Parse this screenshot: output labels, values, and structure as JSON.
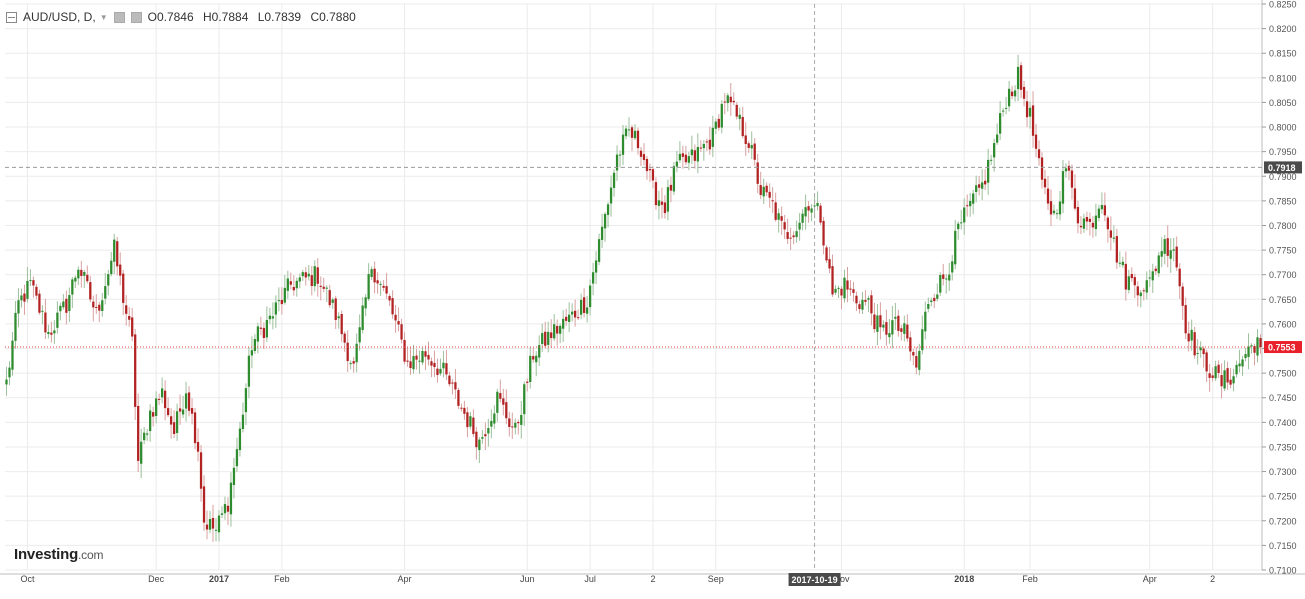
{
  "legend": {
    "symbol": "AUD/USD, D,",
    "open": "O0.7846",
    "high": "H0.7884",
    "low": "L0.7839",
    "close": "C0.7880"
  },
  "logo": {
    "name": "Investing",
    "suffix": ".com"
  },
  "colors": {
    "up": "#2e8b2e",
    "down": "#b22222",
    "wick_up": "#9bbf9b",
    "wick_down": "#d9a0a0",
    "price_line": "#e84040",
    "cross_line": "#b0b0b0",
    "grid": "#ebebeb"
  },
  "chart_data": {
    "type": "candlestick",
    "title": "AUD/USD, D,",
    "ylim": [
      0.71,
      0.825
    ],
    "y_ticks": [
      "0.7100",
      "0.7150",
      "0.7200",
      "0.7250",
      "0.7300",
      "0.7350",
      "0.7400",
      "0.7450",
      "0.7500",
      "0.7550",
      "0.7600",
      "0.7650",
      "0.7700",
      "0.7750",
      "0.7800",
      "0.7850",
      "0.7900",
      "0.7950",
      "0.8000",
      "0.8050",
      "0.8100",
      "0.8150",
      "0.8200",
      "0.8250"
    ],
    "x_ticks": [
      {
        "label": "Oct",
        "index": 7,
        "bold": false
      },
      {
        "label": "Dec",
        "index": 50,
        "bold": false
      },
      {
        "label": "2017",
        "index": 71,
        "bold": true
      },
      {
        "label": "Feb",
        "index": 92,
        "bold": false
      },
      {
        "label": "Apr",
        "index": 133,
        "bold": false
      },
      {
        "label": "Jun",
        "index": 174,
        "bold": false
      },
      {
        "label": "Jul",
        "index": 195,
        "bold": false
      },
      {
        "label": "2",
        "index": 216,
        "bold": false
      },
      {
        "label": "Sep",
        "index": 237,
        "bold": false
      },
      {
        "label": "Nov",
        "index": 279,
        "bold": false
      },
      {
        "label": "2018",
        "index": 320,
        "bold": true
      },
      {
        "label": "Feb",
        "index": 342,
        "bold": false
      },
      {
        "label": "Apr",
        "index": 382,
        "bold": false
      },
      {
        "label": "2",
        "index": 403,
        "bold": false
      }
    ],
    "current_price": {
      "value": 0.7553,
      "label": "0.7553"
    },
    "crosshair": {
      "price": 0.7918,
      "price_label": "0.7918",
      "index": 270,
      "date_label": "2017-10-19"
    },
    "close_anchors": [
      [
        0,
        0.748
      ],
      [
        4,
        0.764
      ],
      [
        8,
        0.768
      ],
      [
        14,
        0.758
      ],
      [
        20,
        0.764
      ],
      [
        24,
        0.772
      ],
      [
        30,
        0.762
      ],
      [
        36,
        0.775
      ],
      [
        42,
        0.756
      ],
      [
        44,
        0.732
      ],
      [
        48,
        0.742
      ],
      [
        52,
        0.746
      ],
      [
        56,
        0.738
      ],
      [
        60,
        0.747
      ],
      [
        64,
        0.735
      ],
      [
        66,
        0.72
      ],
      [
        70,
        0.718
      ],
      [
        74,
        0.724
      ],
      [
        78,
        0.738
      ],
      [
        82,
        0.756
      ],
      [
        88,
        0.761
      ],
      [
        95,
        0.768
      ],
      [
        104,
        0.77
      ],
      [
        110,
        0.762
      ],
      [
        116,
        0.751
      ],
      [
        122,
        0.772
      ],
      [
        128,
        0.764
      ],
      [
        134,
        0.752
      ],
      [
        140,
        0.754
      ],
      [
        146,
        0.75
      ],
      [
        152,
        0.743
      ],
      [
        158,
        0.736
      ],
      [
        164,
        0.745
      ],
      [
        170,
        0.738
      ],
      [
        176,
        0.754
      ],
      [
        182,
        0.758
      ],
      [
        188,
        0.761
      ],
      [
        194,
        0.765
      ],
      [
        200,
        0.782
      ],
      [
        204,
        0.794
      ],
      [
        208,
        0.799
      ],
      [
        212,
        0.796
      ],
      [
        216,
        0.787
      ],
      [
        220,
        0.784
      ],
      [
        224,
        0.792
      ],
      [
        230,
        0.794
      ],
      [
        236,
        0.798
      ],
      [
        240,
        0.806
      ],
      [
        244,
        0.802
      ],
      [
        248,
        0.797
      ],
      [
        252,
        0.787
      ],
      [
        256,
        0.784
      ],
      [
        260,
        0.778
      ],
      [
        264,
        0.78
      ],
      [
        268,
        0.785
      ],
      [
        272,
        0.782
      ],
      [
        276,
        0.766
      ],
      [
        280,
        0.768
      ],
      [
        284,
        0.765
      ],
      [
        288,
        0.764
      ],
      [
        292,
        0.758
      ],
      [
        296,
        0.76
      ],
      [
        300,
        0.758
      ],
      [
        304,
        0.751
      ],
      [
        308,
        0.765
      ],
      [
        314,
        0.77
      ],
      [
        318,
        0.779
      ],
      [
        322,
        0.784
      ],
      [
        326,
        0.788
      ],
      [
        330,
        0.796
      ],
      [
        334,
        0.806
      ],
      [
        338,
        0.81
      ],
      [
        342,
        0.802
      ],
      [
        346,
        0.788
      ],
      [
        350,
        0.782
      ],
      [
        354,
        0.792
      ],
      [
        358,
        0.782
      ],
      [
        362,
        0.78
      ],
      [
        366,
        0.786
      ],
      [
        370,
        0.776
      ],
      [
        374,
        0.769
      ],
      [
        378,
        0.768
      ],
      [
        382,
        0.768
      ],
      [
        386,
        0.776
      ],
      [
        390,
        0.776
      ],
      [
        394,
        0.76
      ],
      [
        398,
        0.754
      ],
      [
        402,
        0.751
      ],
      [
        406,
        0.748
      ],
      [
        410,
        0.75
      ],
      [
        414,
        0.754
      ],
      [
        418,
        0.757
      ],
      [
        419,
        0.7553
      ]
    ],
    "notes": "Daily OHLC candles; bodies green for up days, red for down days; the close path follows close_anchors."
  }
}
